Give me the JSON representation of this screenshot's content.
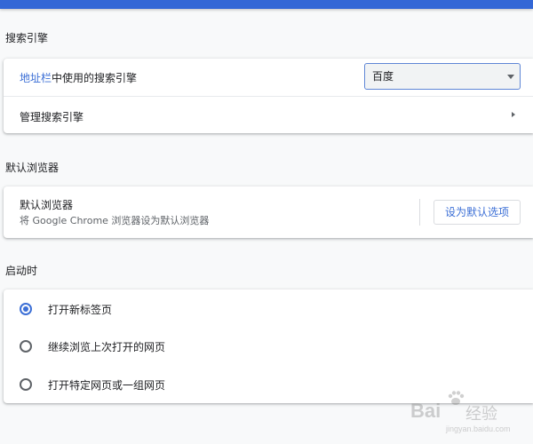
{
  "search_engine": {
    "section_title": "搜索引擎",
    "address_bar_label_link": "地址栏",
    "address_bar_label_rest": "中使用的搜索引擎",
    "selected_engine": "百度",
    "manage_label": "管理搜索引擎"
  },
  "default_browser": {
    "section_title": "默认浏览器",
    "title": "默认浏览器",
    "description": "将 Google Chrome 浏览器设为默认浏览器",
    "make_default_button": "设为默认选项"
  },
  "on_startup": {
    "section_title": "启动时",
    "options": [
      {
        "label": "打开新标签页",
        "checked": true
      },
      {
        "label": "继续浏览上次打开的网页",
        "checked": false
      },
      {
        "label": "打开特定网页或一组网页",
        "checked": false
      }
    ]
  },
  "watermark": {
    "brand": "Bai",
    "brand_cn": "经验",
    "url": "jingyan.baidu.com"
  },
  "colors": {
    "accent": "#3c6fd6",
    "topbar": "#3367d6",
    "background": "#f8f9fa"
  }
}
